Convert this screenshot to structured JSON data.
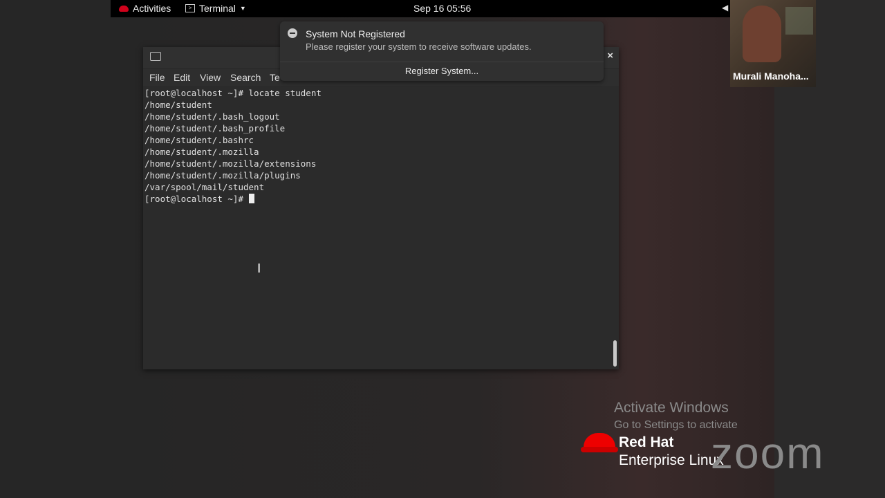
{
  "topbar": {
    "activities_label": "Activities",
    "app_label": "Terminal",
    "clock": "Sep 16  05:56"
  },
  "video": {
    "participant_name": "Murali Manoha..."
  },
  "terminal": {
    "menu": [
      "File",
      "Edit",
      "View",
      "Search",
      "Te"
    ],
    "lines": [
      "[root@localhost ~]# locate student",
      "/home/student",
      "/home/student/.bash_logout",
      "/home/student/.bash_profile",
      "/home/student/.bashrc",
      "/home/student/.mozilla",
      "/home/student/.mozilla/extensions",
      "/home/student/.mozilla/plugins",
      "/var/spool/mail/student"
    ],
    "prompt": "[root@localhost ~]# "
  },
  "notification": {
    "title": "System Not Registered",
    "body": "Please register your system to receive software updates.",
    "action": "Register System..."
  },
  "watermark": {
    "activate_title": "Activate Windows",
    "activate_sub": "Go to Settings to activate",
    "brand_name": "Red Hat",
    "brand_sub": "Enterprise Linux",
    "zoom_logo": "zoom"
  },
  "icons": {
    "close": "×"
  }
}
